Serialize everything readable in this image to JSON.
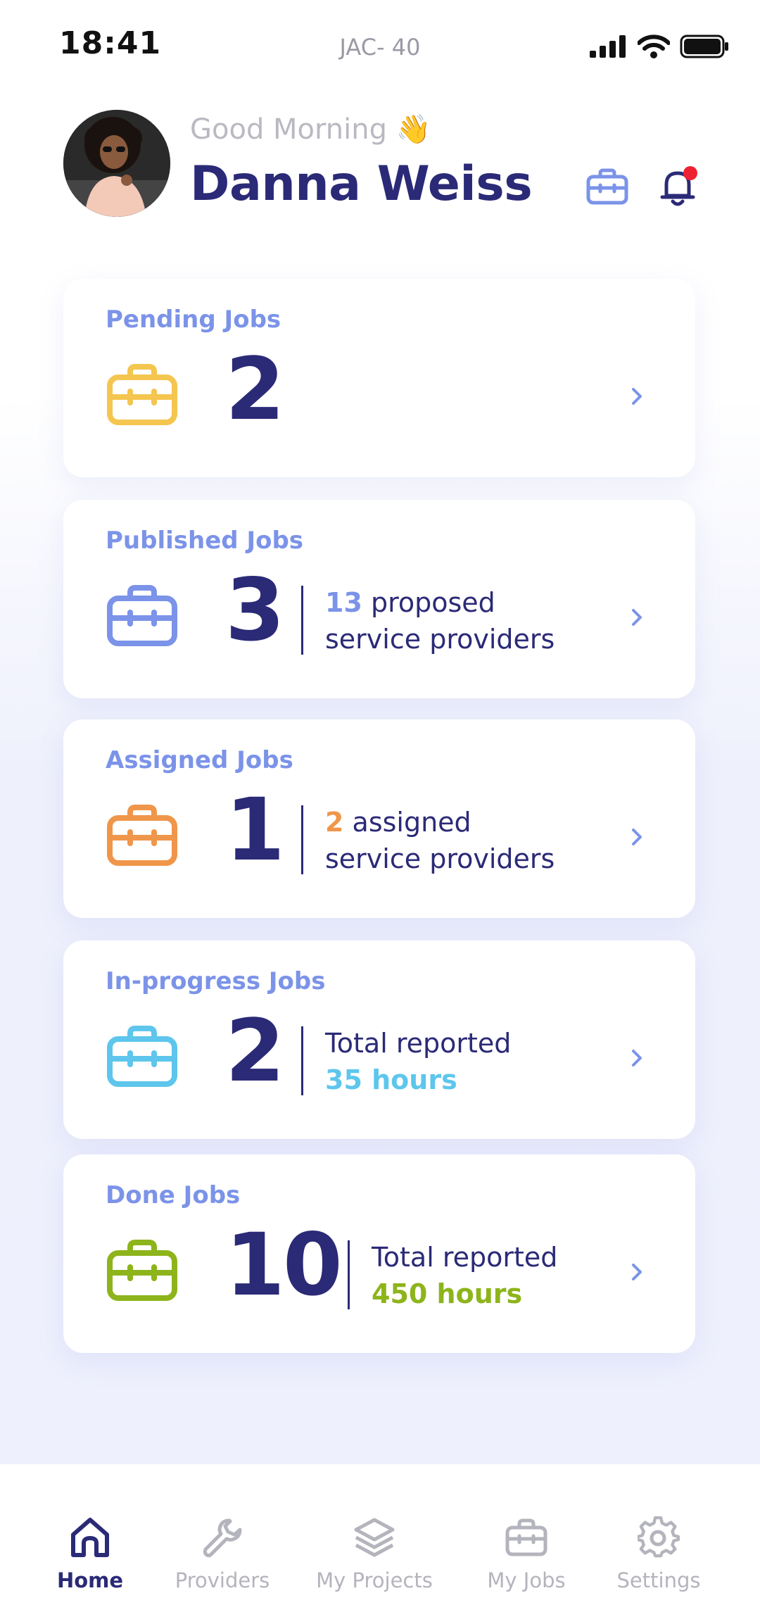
{
  "status_bar": {
    "time": "18:41",
    "center_label": "JAC- 40"
  },
  "header": {
    "greeting": "Good Morning 👋",
    "user_name": "Danna Weiss"
  },
  "cards": [
    {
      "title": "Pending Jobs",
      "count": "2",
      "color": "#f4c64f"
    },
    {
      "title": "Published Jobs",
      "count": "3",
      "color": "#7b93e8",
      "detail_highlight": "13",
      "detail_text1": " proposed",
      "detail_text2": "service providers"
    },
    {
      "title": "Assigned Jobs",
      "count": "1",
      "color": "#f0964a",
      "detail_highlight": "2",
      "detail_text1": " assigned",
      "detail_text2": "service providers"
    },
    {
      "title": "In-progress Jobs",
      "count": "2",
      "color": "#5ec6ec",
      "detail_text1": "Total reported",
      "detail_highlight": "35 hours"
    },
    {
      "title": "Done Jobs",
      "count": "10",
      "color": "#8db41b",
      "detail_text1": "Total reported",
      "detail_highlight": "450 hours"
    }
  ],
  "bottom_nav": [
    {
      "label": "Home",
      "icon": "home-icon",
      "active": true
    },
    {
      "label": "Providers",
      "icon": "wrench-icon",
      "active": false
    },
    {
      "label": "My Projects",
      "icon": "layers-icon",
      "active": false
    },
    {
      "label": "My Jobs",
      "icon": "briefcase-icon",
      "active": false
    },
    {
      "label": "Settings",
      "icon": "gear-icon",
      "active": false
    }
  ],
  "colors": {
    "primary": "#2b2a77",
    "accent": "#7b93e8",
    "notification": "#ee2233",
    "inactive": "#b4b4bd"
  }
}
